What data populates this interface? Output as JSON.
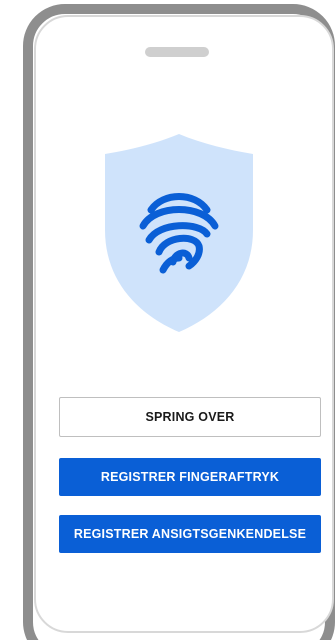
{
  "screen": {
    "skip_button_label": "SPRING OVER",
    "fingerprint_button_label": "REGISTRER FINGERAFTRYK",
    "face_button_label": "REGISTRER ANSIGTSGENKENDELSE"
  },
  "icons": {
    "shield": "shield-icon",
    "fingerprint": "fingerprint-icon"
  },
  "colors": {
    "frame": "#8e8e8e",
    "shield_fill": "#cfe3fb",
    "fingerprint_stroke": "#0a5fd6",
    "primary_button": "#0a5fd6",
    "primary_button_text": "#ffffff",
    "secondary_button_border": "#bfbfbf"
  }
}
